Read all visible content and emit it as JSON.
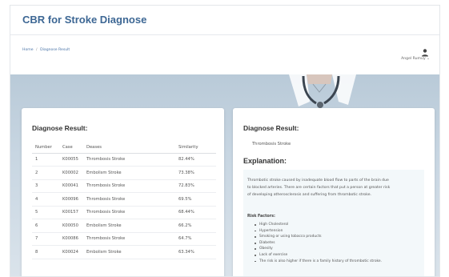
{
  "app": {
    "title": "CBR for Stroke Diagnose"
  },
  "breadcrumb": {
    "home": "Home",
    "separator": "/",
    "current": "Diagnose Result"
  },
  "user": {
    "name": "Angel Rumuy",
    "chevron": "⌄",
    "icon": "user-icon"
  },
  "results_card": {
    "title": "Diagnose Result:",
    "columns": [
      "Number",
      "Case",
      "Deases",
      "Similarity"
    ],
    "rows": [
      [
        "1",
        "K00055",
        "Thrombosis Stroke",
        "82.44%"
      ],
      [
        "2",
        "K00002",
        "Embolism Stroke",
        "73.38%"
      ],
      [
        "3",
        "K00041",
        "Thrombosis Stroke",
        "72.83%"
      ],
      [
        "4",
        "K00096",
        "Thrombosis Stroke",
        "69.5%"
      ],
      [
        "5",
        "K00157",
        "Thrombosis Stroke",
        "68.44%"
      ],
      [
        "6",
        "K00050",
        "Embolism Stroke",
        "66.2%"
      ],
      [
        "7",
        "K00086",
        "Thrombosis Stroke",
        "64.7%"
      ],
      [
        "8",
        "K00024",
        "Embolism Stroke",
        "63.34%"
      ]
    ]
  },
  "diagnosis_card": {
    "title": "Diagnose Result:",
    "value": "Thrombosis Stroke",
    "explanation_title": "Explanation:",
    "explanation_line1": "Thrombotic stroke caused by inadequate blood flow to parts of the brain due",
    "explanation_line2": "to blocked arteries. There are certain factors that put a person at greater risk",
    "explanation_line3": "of developing atherosclerosis and suffering from thrombotic stroke.",
    "risk_title": "Risk Factors:",
    "risk_factors": [
      "High Cholesterol",
      "Hypertension",
      "Smoking or using tobacco products",
      "Diabetes",
      "Obesity",
      "Lack of exercise",
      "The risk is also higher if there is a family history of thrombotic stroke."
    ]
  }
}
